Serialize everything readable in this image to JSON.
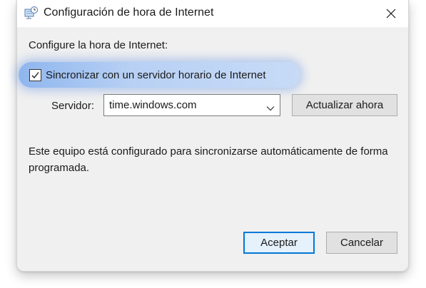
{
  "window": {
    "title": "Configuración de hora de Internet",
    "icon": "clock-network-icon",
    "close_icon": "close-icon"
  },
  "main": {
    "heading": "Configure la hora de Internet:",
    "sync_checkbox": {
      "label": "Sincronizar con un servidor horario de Internet",
      "checked": true
    },
    "server": {
      "label": "Servidor:",
      "selected_value": "time.windows.com"
    },
    "update_button_label": "Actualizar ahora",
    "status_text": "Este equipo está configurado para sincronizarse automáticamente de forma programada."
  },
  "footer": {
    "ok_label": "Aceptar",
    "cancel_label": "Cancelar"
  },
  "colors": {
    "dialog_background": "#f0f0f0",
    "highlight": "#b7d0f4",
    "accent_border": "#0078d7"
  }
}
